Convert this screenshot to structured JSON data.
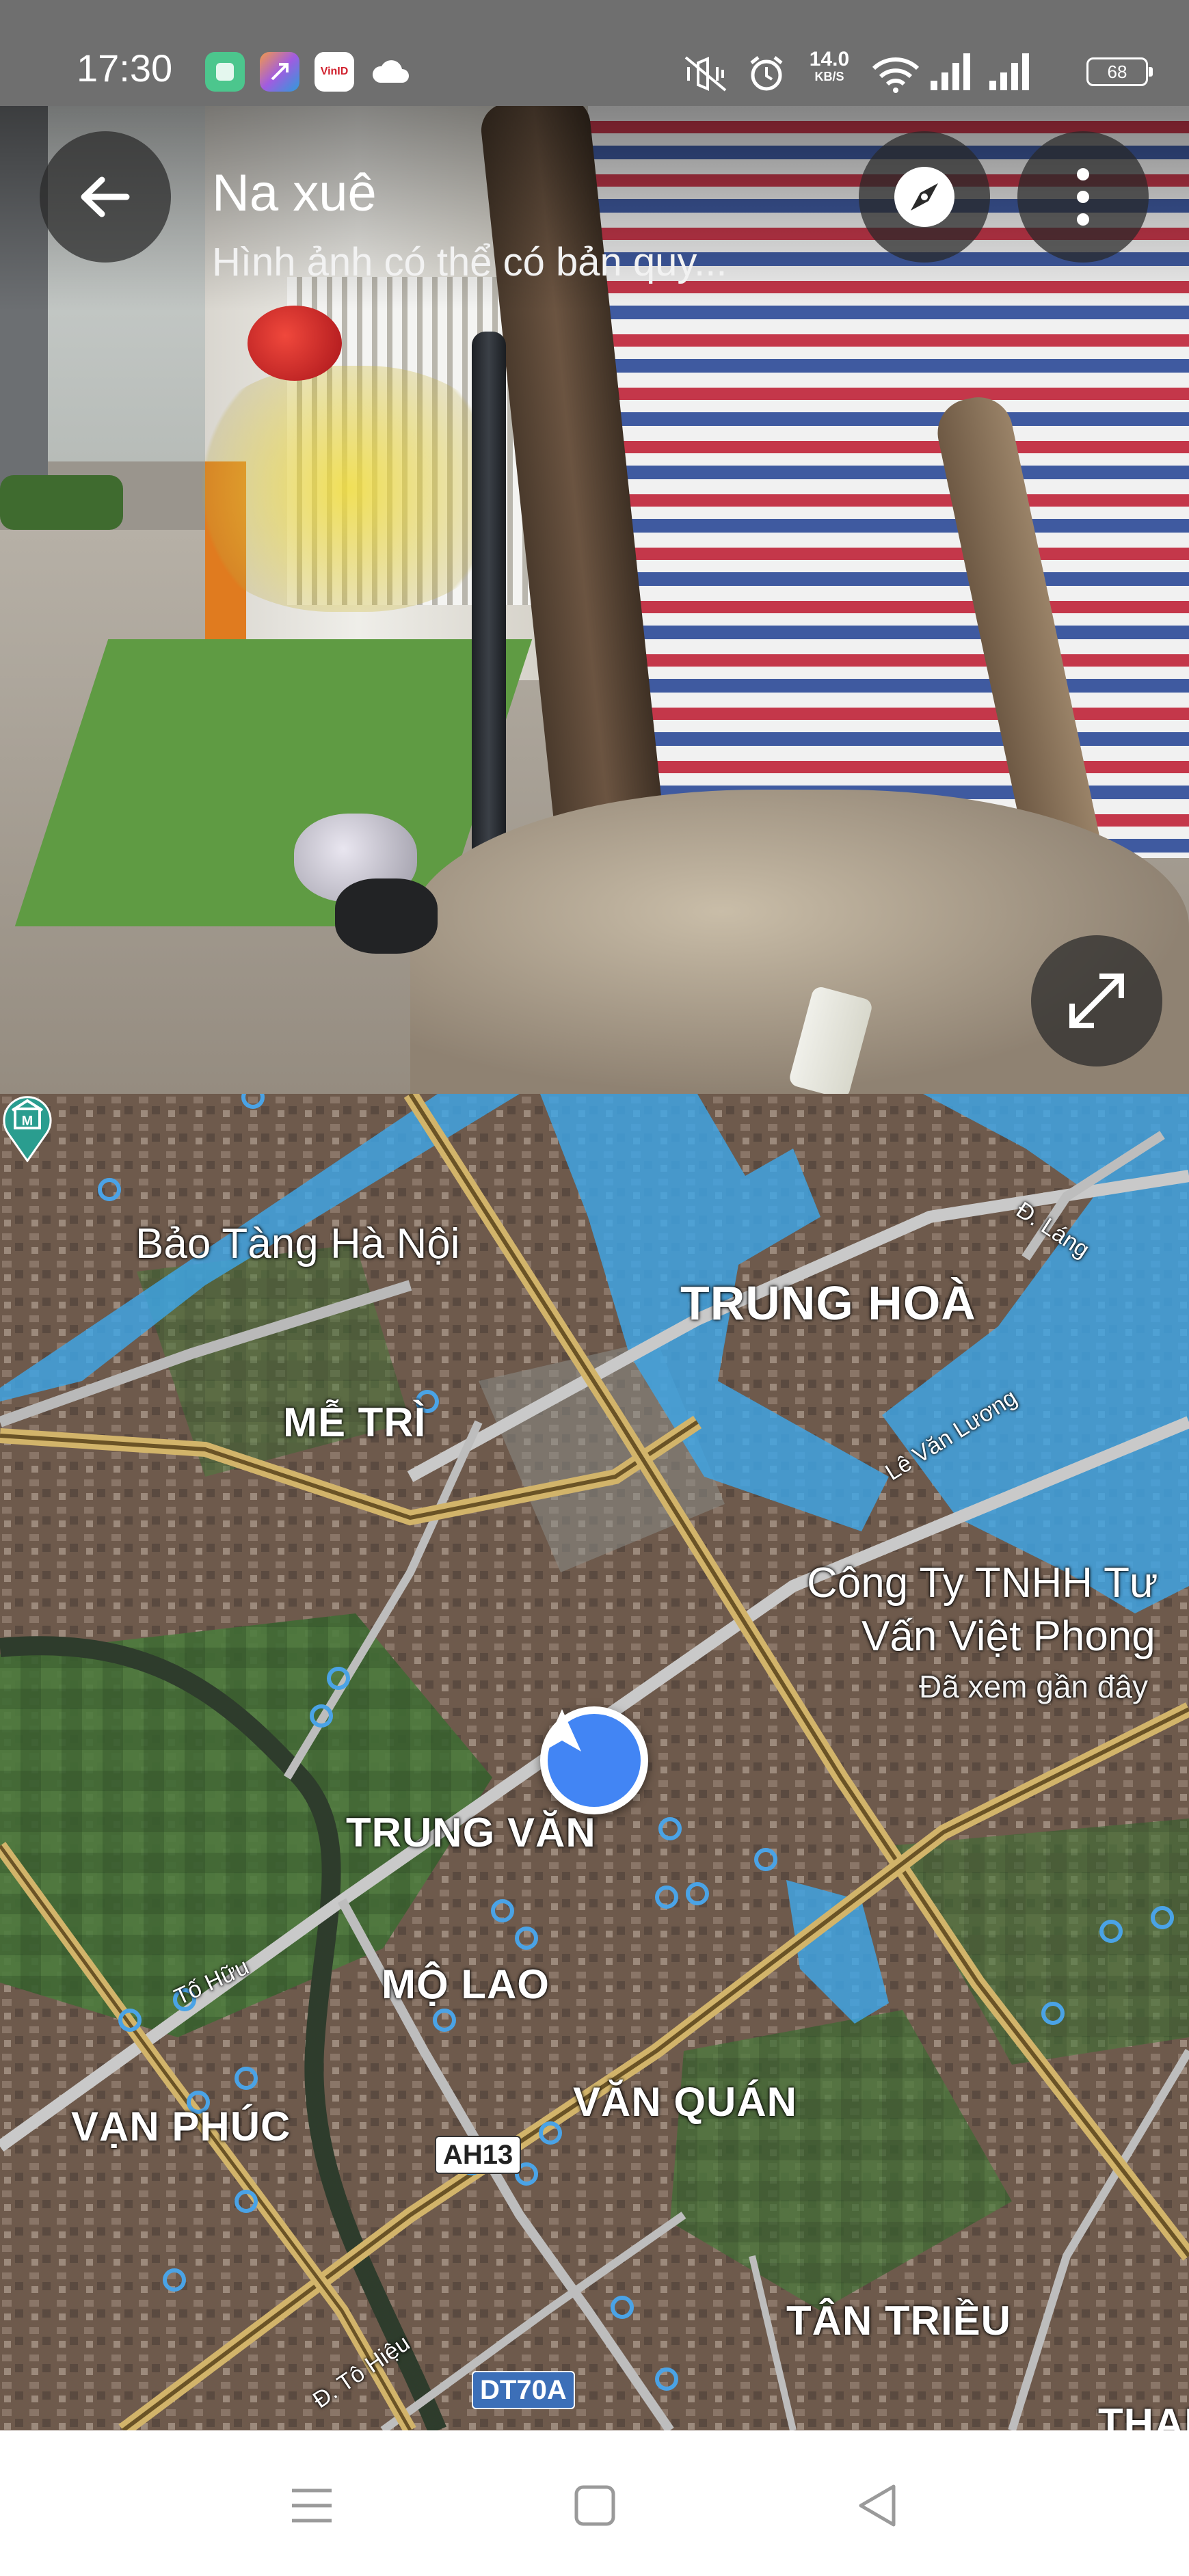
{
  "status_bar": {
    "time": "17:30",
    "app_icons": [
      {
        "name": "green-app-icon",
        "color": "#4cc68d",
        "text": ""
      },
      {
        "name": "colorful-app-icon",
        "color": "#a05ce0",
        "text": ""
      },
      {
        "name": "vinid-app-icon",
        "color": "#ffffff",
        "text": "VinID"
      },
      {
        "name": "cloud-icon",
        "color": "#ffffff",
        "text": ""
      }
    ],
    "net_speed_value": "14.0",
    "net_speed_unit": "KB/S",
    "battery": "68"
  },
  "street_view": {
    "title": "Na xuê",
    "subtitle": "Hình ảnh có thể có bản quy...",
    "icons": {
      "back": "arrow-left-icon",
      "compass": "compass-icon",
      "more": "more-vertical-icon",
      "expand": "expand-icon"
    }
  },
  "map": {
    "poi": {
      "museum": "Bảo Tàng Hà Nội",
      "company_line1": "Công Ty TNHH Tư",
      "company_line2": "Vấn Việt Phong",
      "company_status": "Đã xem gần đây"
    },
    "districts": {
      "trung_hoa": "TRUNG HOÀ",
      "me_tri": "MỄ TRÌ",
      "trung_van": "TRUNG VĂN",
      "mo_lao": "MỘ LAO",
      "van_phuc": "VẠN PHÚC",
      "van_quan": "VĂN QUÁN",
      "tan_trieu": "TÂN TRIỀU",
      "thanh": "THAN"
    },
    "roads": {
      "d_lang": "Đ. Láng",
      "le_van_luong": "Lê Văn Lương",
      "to_huu": "Tố Hữu",
      "d_to_hieu": "Đ. Tô Hiệu"
    },
    "shields": {
      "ah13": "AH13",
      "dt70a": "DT70A"
    },
    "colors": {
      "flood_overlay": "#3ea6e8",
      "location_blue": "#4285f4",
      "museum_teal": "#2a9d8f"
    }
  },
  "nav_bar": {
    "icons": [
      "menu-icon",
      "home-square-icon",
      "back-triangle-icon"
    ]
  }
}
